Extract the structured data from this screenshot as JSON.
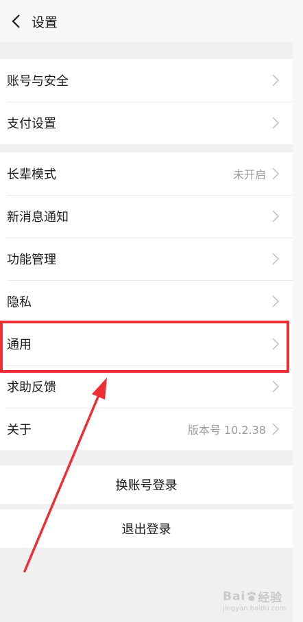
{
  "header": {
    "title": "设置"
  },
  "groups": [
    {
      "items": [
        {
          "label": "账号与安全"
        },
        {
          "label": "支付设置"
        }
      ]
    },
    {
      "items": [
        {
          "label": "长辈模式",
          "value": "未开启"
        },
        {
          "label": "新消息通知"
        },
        {
          "label": "功能管理"
        },
        {
          "label": "隐私"
        },
        {
          "label": "通用"
        },
        {
          "label": "求助反馈"
        },
        {
          "label": "关于",
          "value": "版本号 10.2.38"
        }
      ]
    }
  ],
  "actions": {
    "switch_account": "换账号登录",
    "logout": "退出登录"
  },
  "watermark": {
    "brand": "Bai",
    "brand_suffix": "经验",
    "url": "jingyan.baidu.com"
  },
  "colors": {
    "highlight": "#ee2e35",
    "background": "#f0f0f0"
  }
}
